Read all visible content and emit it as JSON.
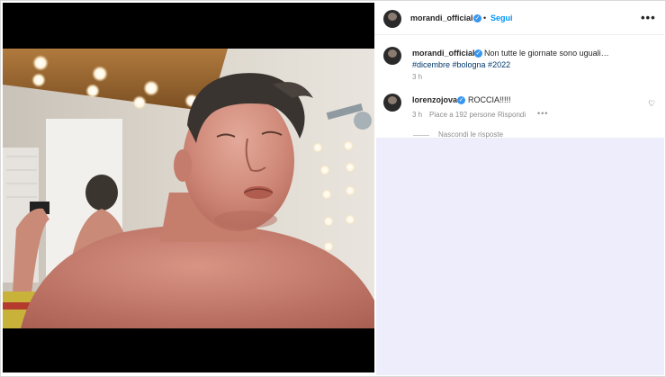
{
  "post": {
    "author": "morandi_official",
    "follow_label": "Segui",
    "separator": "•",
    "caption_text": "Non tutte le giornate sono uguali…",
    "hashtags": "#dicembre #bologna #2022",
    "caption_time": "3 h",
    "options_label": "•••"
  },
  "comment": {
    "author": "lorenzojova",
    "text": "ROCCIA!!!!!",
    "time": "3 h",
    "likes": "Piace a 192 persone",
    "reply_label": "Rispondi",
    "options_label": "•••",
    "like_icon": "heart-icon"
  },
  "replies": {
    "hide_label": "Nascondi le risposte"
  },
  "icons": {
    "verified": "verified-badge-icon",
    "more": "more-options-icon"
  },
  "colors": {
    "link_blue": "#0095f6",
    "hashtag": "#00376b",
    "muted": "#8e8e8e",
    "verified": "#3897f0"
  }
}
